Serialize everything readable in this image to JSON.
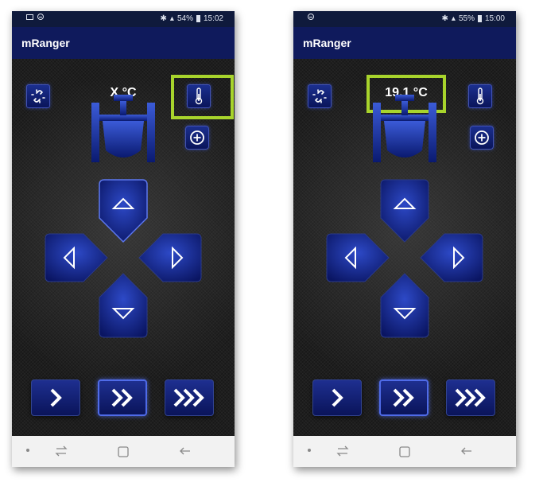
{
  "screens": [
    {
      "statusbar": {
        "battery": "54%",
        "time": "15:02"
      },
      "app_title": "mRanger",
      "temperature": "X °C",
      "highlight": "thermometer-button"
    },
    {
      "statusbar": {
        "battery": "55%",
        "time": "15:00"
      },
      "app_title": "mRanger",
      "temperature": "19.1 °C",
      "highlight": "temperature-readout"
    }
  ],
  "colors": {
    "highlight": "#a8d42c",
    "button_blue": "#1b2f8f",
    "appbar": "#0f1a5c"
  },
  "icons": [
    "link-break-icon",
    "thermometer-icon",
    "add-circle-icon",
    "valve-icon",
    "arrow-up-icon",
    "arrow-left-icon",
    "arrow-right-icon",
    "arrow-down-icon",
    "chevron-single-icon",
    "chevron-double-icon",
    "chevron-triple-icon"
  ]
}
